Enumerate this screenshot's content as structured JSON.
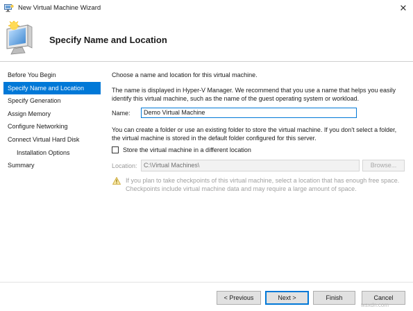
{
  "window": {
    "title": "New Virtual Machine Wizard",
    "close_glyph": "✕"
  },
  "header": {
    "title": "Specify Name and Location",
    "icon": "virtual-machine-icon"
  },
  "nav": {
    "items": [
      {
        "label": "Before You Begin",
        "selected": false,
        "indent": false
      },
      {
        "label": "Specify Name and Location",
        "selected": true,
        "indent": false
      },
      {
        "label": "Specify Generation",
        "selected": false,
        "indent": false
      },
      {
        "label": "Assign Memory",
        "selected": false,
        "indent": false
      },
      {
        "label": "Configure Networking",
        "selected": false,
        "indent": false
      },
      {
        "label": "Connect Virtual Hard Disk",
        "selected": false,
        "indent": false
      },
      {
        "label": "Installation Options",
        "selected": false,
        "indent": true
      },
      {
        "label": "Summary",
        "selected": false,
        "indent": false
      }
    ]
  },
  "main": {
    "intro": "Choose a name and location for this virtual machine.",
    "description": "The name is displayed in Hyper-V Manager. We recommend that you use a name that helps you easily identify this virtual machine, such as the name of the guest operating system or workload.",
    "name_label": "Name:",
    "name_value": "Demo Virtual Machine",
    "folder_text": "You can create a folder or use an existing folder to store the virtual machine. If you don't select a folder, the virtual machine is stored in the default folder configured for this server.",
    "checkbox_label": "Store the virtual machine in a different location",
    "checkbox_checked": false,
    "location_label": "Location:",
    "location_value": "C:\\Virtual Machines\\",
    "browse_label": "Browse...",
    "warning_text": "If you plan to take checkpoints of this virtual machine, select a location that has enough free space. Checkpoints include virtual machine data and may require a large amount of space."
  },
  "footer": {
    "previous_label": "< Previous",
    "next_label": "Next >",
    "finish_label": "Finish",
    "cancel_label": "Cancel"
  },
  "watermark": "wsxdn.com",
  "colors": {
    "accent": "#0078d7",
    "disabled_text": "#a0a0a0",
    "button_bg": "#e1e1e1"
  }
}
